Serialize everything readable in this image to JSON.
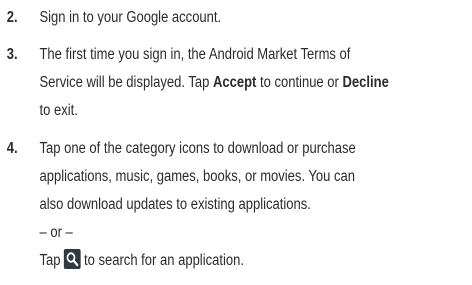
{
  "steps": [
    {
      "number": "2.",
      "lines": [
        "Sign in to your Google account."
      ]
    },
    {
      "number": "3.",
      "line1": "The first time you sign in, the Android Market Terms of",
      "line2_pre": "Service will be displayed. Tap ",
      "accept": "Accept",
      "line2_mid": " to continue or ",
      "decline": "Decline",
      "line3": "to exit."
    },
    {
      "number": "4.",
      "line1": "Tap one of the category icons to download or purchase",
      "line2": "applications, music, games, books, or movies. You can",
      "line3": "also download updates to existing applications.",
      "or_text": "– or –",
      "tap_pre": "Tap",
      "tap_post": "to search for an application.",
      "icon": "search-icon"
    }
  ]
}
